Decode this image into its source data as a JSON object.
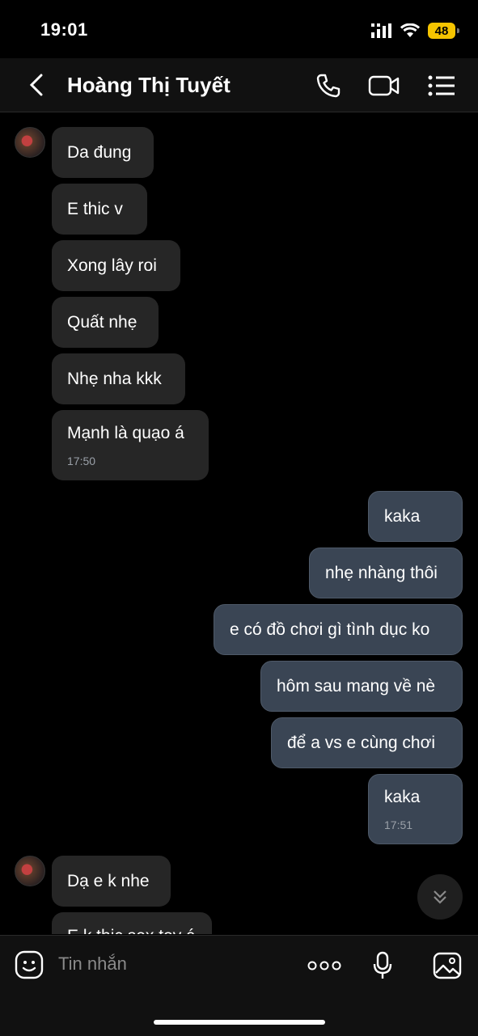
{
  "status_bar": {
    "time": "19:01",
    "battery": "48"
  },
  "header": {
    "contact_name": "Hoàng Thị Tuyết"
  },
  "messages": [
    {
      "text": "Da đung"
    },
    {
      "text": "E thic v"
    },
    {
      "text": "Xong lây roi"
    },
    {
      "text": "Quất nhẹ"
    },
    {
      "text": "Nhẹ nha kkk"
    },
    {
      "text": "Mạnh là quạo á",
      "time": "17:50"
    },
    {
      "text": "kaka"
    },
    {
      "text": "nhẹ nhàng thôi"
    },
    {
      "text": "e có đồ chơi gì tình dục ko"
    },
    {
      "text": "hôm sau mang về nè"
    },
    {
      "text": "để a vs e cùng chơi"
    },
    {
      "text": "kaka",
      "time": "17:51"
    },
    {
      "text": "Dạ e k nhe"
    },
    {
      "text": "E k thic sex toy á"
    }
  ],
  "input": {
    "placeholder": "Tin nhắn"
  },
  "colors": {
    "background": "#000000",
    "incoming_bubble": "#262626",
    "outgoing_bubble": "#3a4554",
    "battery": "#f5c400"
  }
}
